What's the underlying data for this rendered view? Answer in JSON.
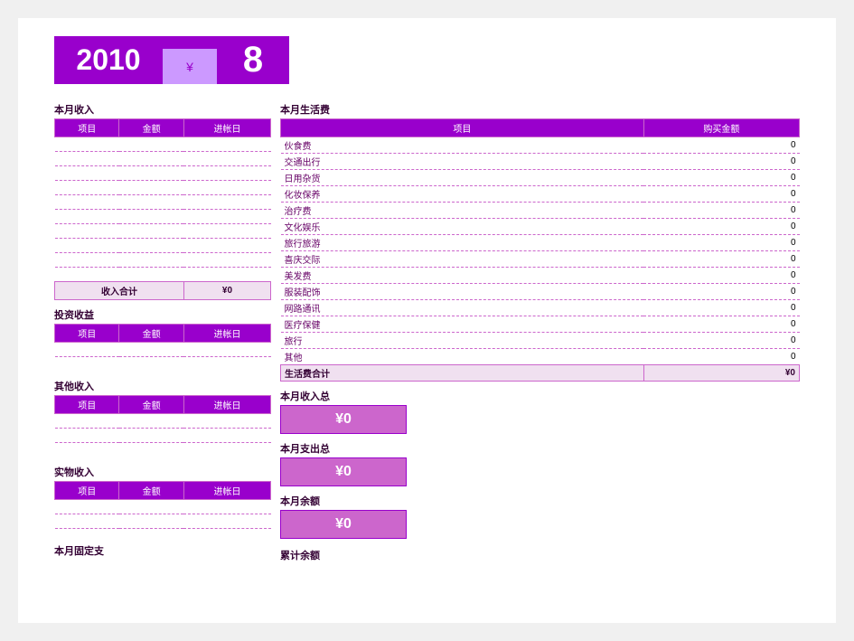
{
  "header": {
    "year": "2010",
    "yen_symbol": "¥",
    "month": "8"
  },
  "left": {
    "income_section": {
      "title": "本月收入",
      "columns": [
        "项目",
        "金额",
        "进帐日"
      ],
      "rows": [
        [
          "",
          "",
          ""
        ],
        [
          "",
          "",
          ""
        ],
        [
          "",
          "",
          ""
        ],
        [
          "",
          "",
          ""
        ],
        [
          "",
          "",
          ""
        ],
        [
          "",
          "",
          ""
        ],
        [
          "",
          "",
          ""
        ],
        [
          "",
          "",
          ""
        ],
        [
          "",
          "",
          ""
        ],
        [
          "",
          "",
          ""
        ]
      ],
      "sum_label": "收入合计",
      "sum_value": "¥0"
    },
    "investment_section": {
      "title": "投资收益",
      "columns": [
        "项目",
        "金额",
        "进帐日"
      ],
      "rows": [
        [
          "",
          "",
          ""
        ]
      ]
    },
    "other_income_section": {
      "title": "其他收入",
      "columns": [
        "项目",
        "金额",
        "进帐日"
      ],
      "rows": [
        [
          "",
          "",
          ""
        ],
        [
          "",
          "",
          ""
        ]
      ]
    },
    "real_income_section": {
      "title": "实物收入",
      "columns": [
        "项目",
        "金额",
        "进帐日"
      ],
      "rows": [
        [
          "",
          "",
          ""
        ],
        [
          "",
          "",
          ""
        ]
      ]
    },
    "fixed_expense_label": "本月固定支"
  },
  "right": {
    "living_section": {
      "title": "本月生活费",
      "columns": [
        "项目",
        "购买金额"
      ],
      "rows": [
        [
          "伙食费",
          "0"
        ],
        [
          "交通出行",
          "0"
        ],
        [
          "日用杂货",
          "0"
        ],
        [
          "化妆保养",
          "0"
        ],
        [
          "治疗费",
          "0"
        ],
        [
          "文化娱乐",
          "0"
        ],
        [
          "旅行旅游",
          "0"
        ],
        [
          "喜庆交际",
          "0"
        ],
        [
          "美发费",
          "0"
        ],
        [
          "服装配饰",
          "0"
        ],
        [
          "网路通讯",
          "0"
        ],
        [
          "医疗保健",
          "0"
        ],
        [
          "旅行",
          "0"
        ],
        [
          "其他",
          "0"
        ]
      ],
      "sum_label": "生活费合计",
      "sum_value": "¥0"
    },
    "total_income": {
      "label": "本月收入总",
      "value": "¥0"
    },
    "total_expense": {
      "label": "本月支出总",
      "value": "¥0"
    },
    "monthly_balance": {
      "label": "本月余额",
      "value": "¥0"
    },
    "cumulative_balance_label": "累计余额"
  }
}
